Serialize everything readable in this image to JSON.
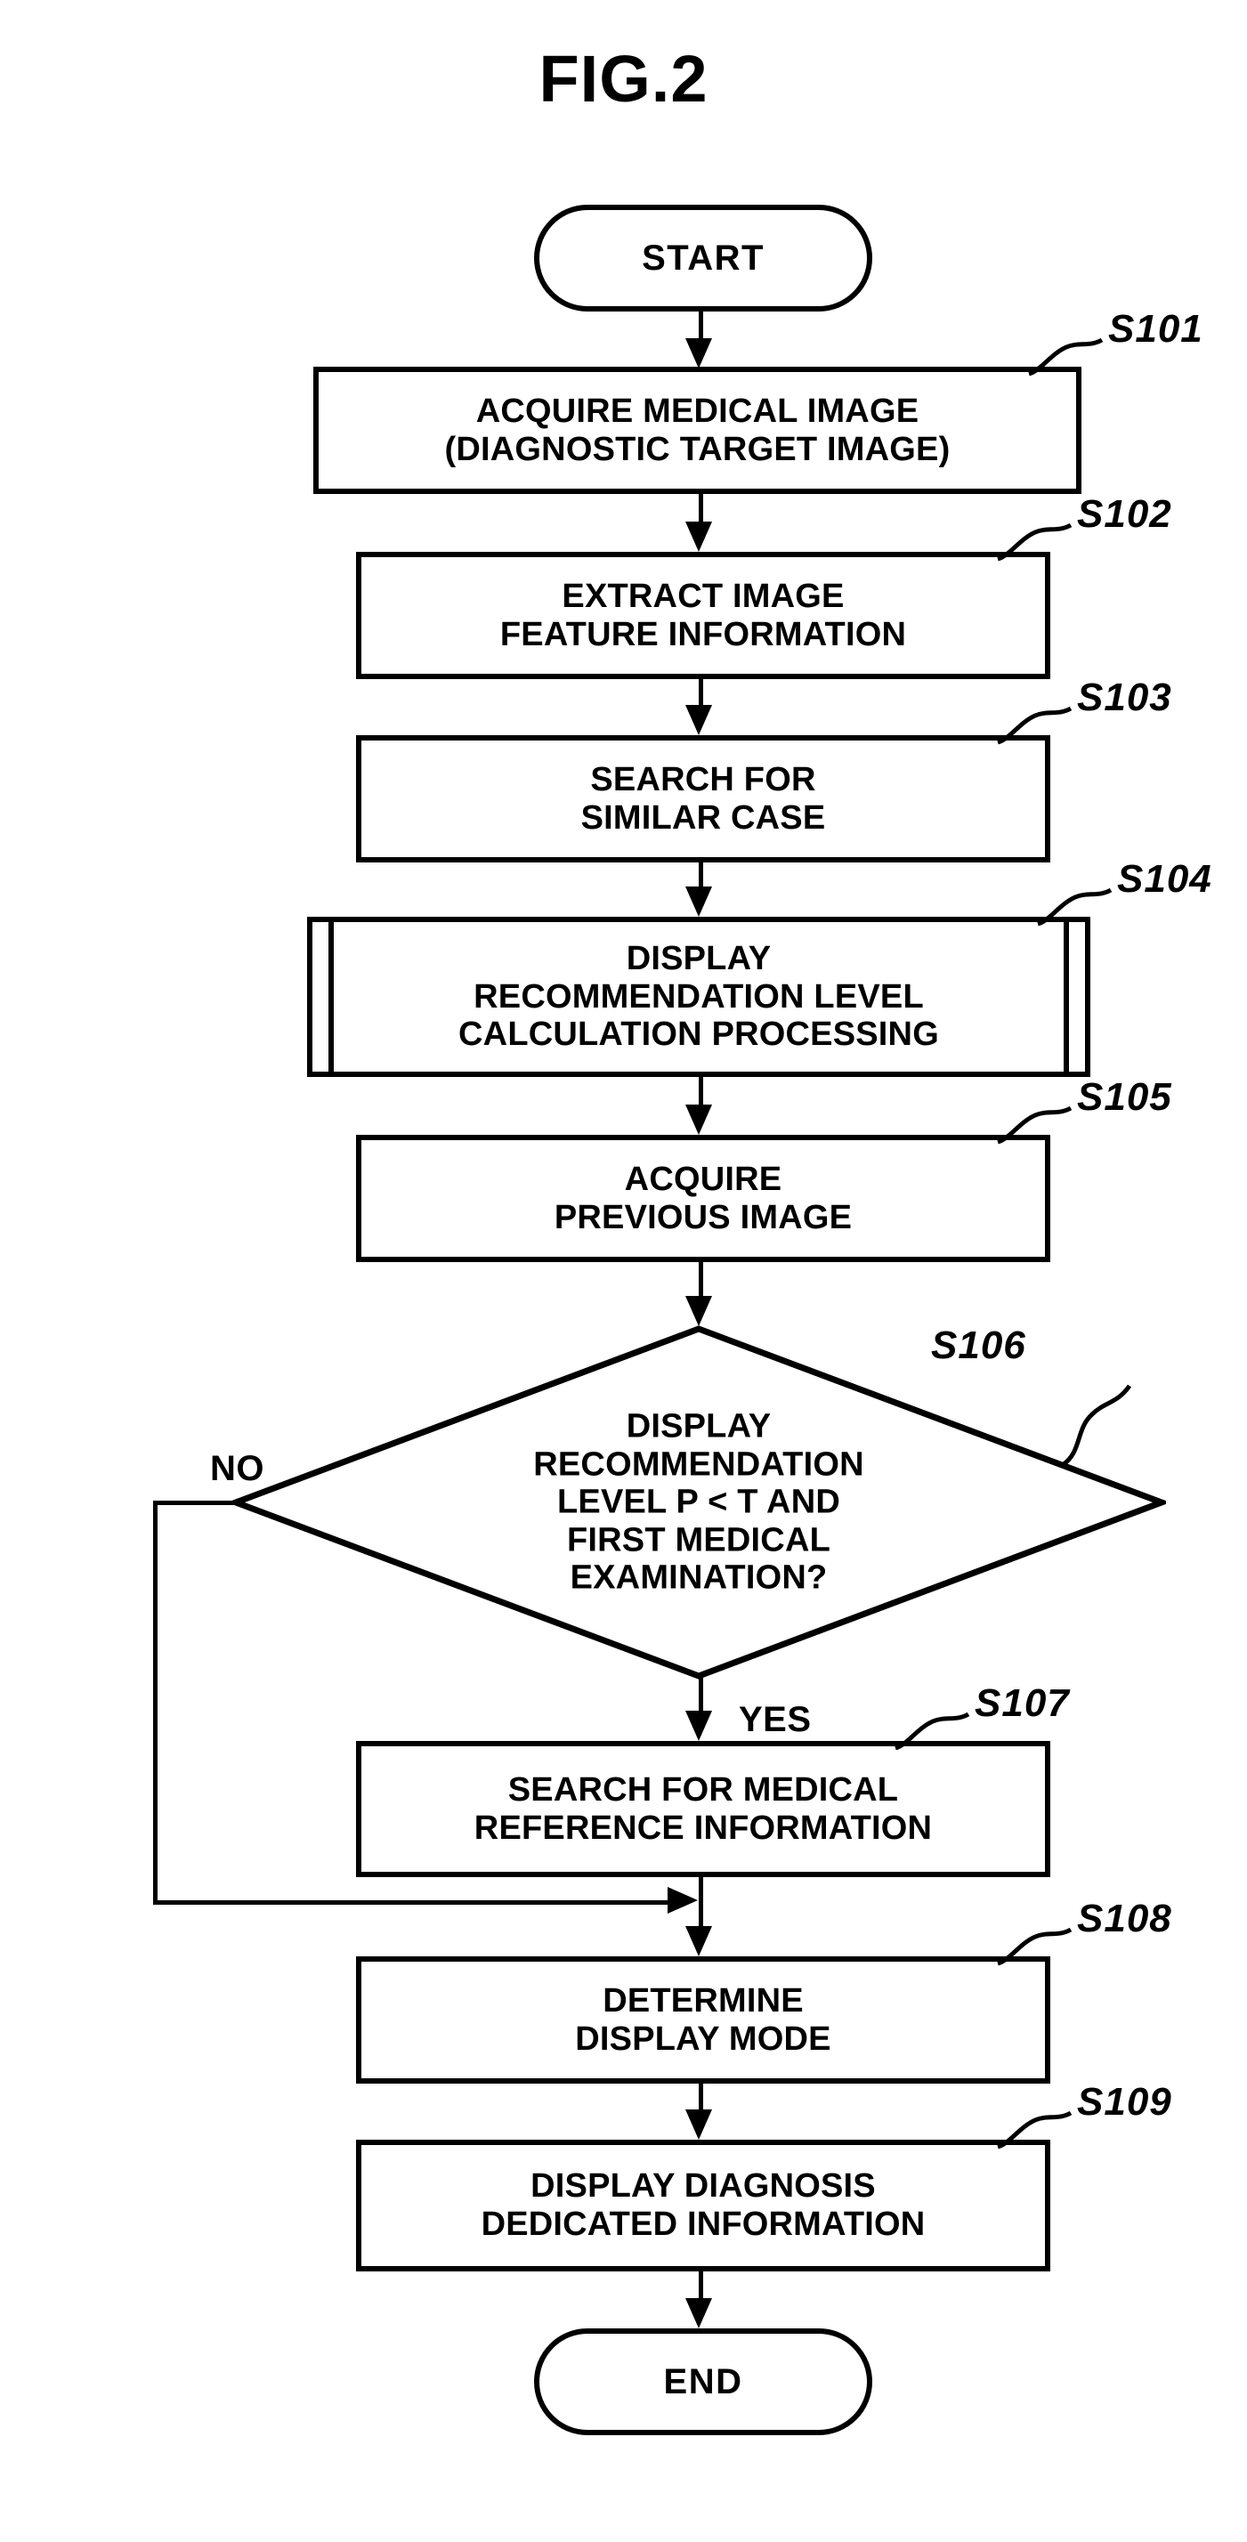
{
  "figure": {
    "title": "FIG.2",
    "type": "flowchart"
  },
  "chart_data": {
    "type": "diagram",
    "title": "FIG.2",
    "nodes": [
      {
        "id": "start",
        "shape": "terminal",
        "step": "",
        "text": "START"
      },
      {
        "id": "s101",
        "shape": "process",
        "step": "S101",
        "text": "ACQUIRE MEDICAL IMAGE\n(DIAGNOSTIC TARGET IMAGE)"
      },
      {
        "id": "s102",
        "shape": "process",
        "step": "S102",
        "text": "EXTRACT IMAGE\nFEATURE INFORMATION"
      },
      {
        "id": "s103",
        "shape": "process",
        "step": "S103",
        "text": "SEARCH FOR\nSIMILAR CASE"
      },
      {
        "id": "s104",
        "shape": "predefined-process",
        "step": "S104",
        "text": "DISPLAY\nRECOMMENDATION LEVEL\nCALCULATION PROCESSING"
      },
      {
        "id": "s105",
        "shape": "process",
        "step": "S105",
        "text": "ACQUIRE\nPREVIOUS IMAGE"
      },
      {
        "id": "s106",
        "shape": "decision",
        "step": "S106",
        "text": "DISPLAY\nRECOMMENDATION\nLEVEL P < T AND\nFIRST MEDICAL\nEXAMINATION?"
      },
      {
        "id": "s107",
        "shape": "process",
        "step": "S107",
        "text": "SEARCH FOR MEDICAL\nREFERENCE INFORMATION"
      },
      {
        "id": "s108",
        "shape": "process",
        "step": "S108",
        "text": "DETERMINE\nDISPLAY MODE"
      },
      {
        "id": "s109",
        "shape": "process",
        "step": "S109",
        "text": "DISPLAY DIAGNOSIS\nDEDICATED INFORMATION"
      },
      {
        "id": "end",
        "shape": "terminal",
        "step": "",
        "text": "END"
      }
    ],
    "edges": [
      {
        "from": "start",
        "to": "s101",
        "label": ""
      },
      {
        "from": "s101",
        "to": "s102",
        "label": ""
      },
      {
        "from": "s102",
        "to": "s103",
        "label": ""
      },
      {
        "from": "s103",
        "to": "s104",
        "label": ""
      },
      {
        "from": "s104",
        "to": "s105",
        "label": ""
      },
      {
        "from": "s105",
        "to": "s106",
        "label": ""
      },
      {
        "from": "s106",
        "to": "s107",
        "label": "YES"
      },
      {
        "from": "s106",
        "to": "s108",
        "label": "NO"
      },
      {
        "from": "s107",
        "to": "s108",
        "label": ""
      },
      {
        "from": "s108",
        "to": "s109",
        "label": ""
      },
      {
        "from": "s109",
        "to": "end",
        "label": ""
      }
    ]
  },
  "nodes": {
    "start": {
      "text": "START"
    },
    "s101": {
      "text": "ACQUIRE MEDICAL IMAGE\n(DIAGNOSTIC TARGET IMAGE)",
      "step": "S101"
    },
    "s102": {
      "text": "EXTRACT IMAGE\nFEATURE INFORMATION",
      "step": "S102"
    },
    "s103": {
      "text": "SEARCH FOR\nSIMILAR CASE",
      "step": "S103"
    },
    "s104": {
      "text": "DISPLAY\nRECOMMENDATION LEVEL\nCALCULATION PROCESSING",
      "step": "S104"
    },
    "s105": {
      "text": "ACQUIRE\nPREVIOUS IMAGE",
      "step": "S105"
    },
    "s106": {
      "text": "DISPLAY\nRECOMMENDATION\nLEVEL P < T AND\nFIRST MEDICAL\nEXAMINATION?",
      "step": "S106"
    },
    "s107": {
      "text": "SEARCH FOR MEDICAL\nREFERENCE INFORMATION",
      "step": "S107"
    },
    "s108": {
      "text": "DETERMINE\nDISPLAY MODE",
      "step": "S108"
    },
    "s109": {
      "text": "DISPLAY DIAGNOSIS\nDEDICATED INFORMATION",
      "step": "S109"
    },
    "end": {
      "text": "END"
    }
  },
  "branch_labels": {
    "no": "NO",
    "yes": "YES"
  },
  "colors": {
    "stroke": "#000000",
    "fill": "#ffffff",
    "text": "#000000"
  }
}
